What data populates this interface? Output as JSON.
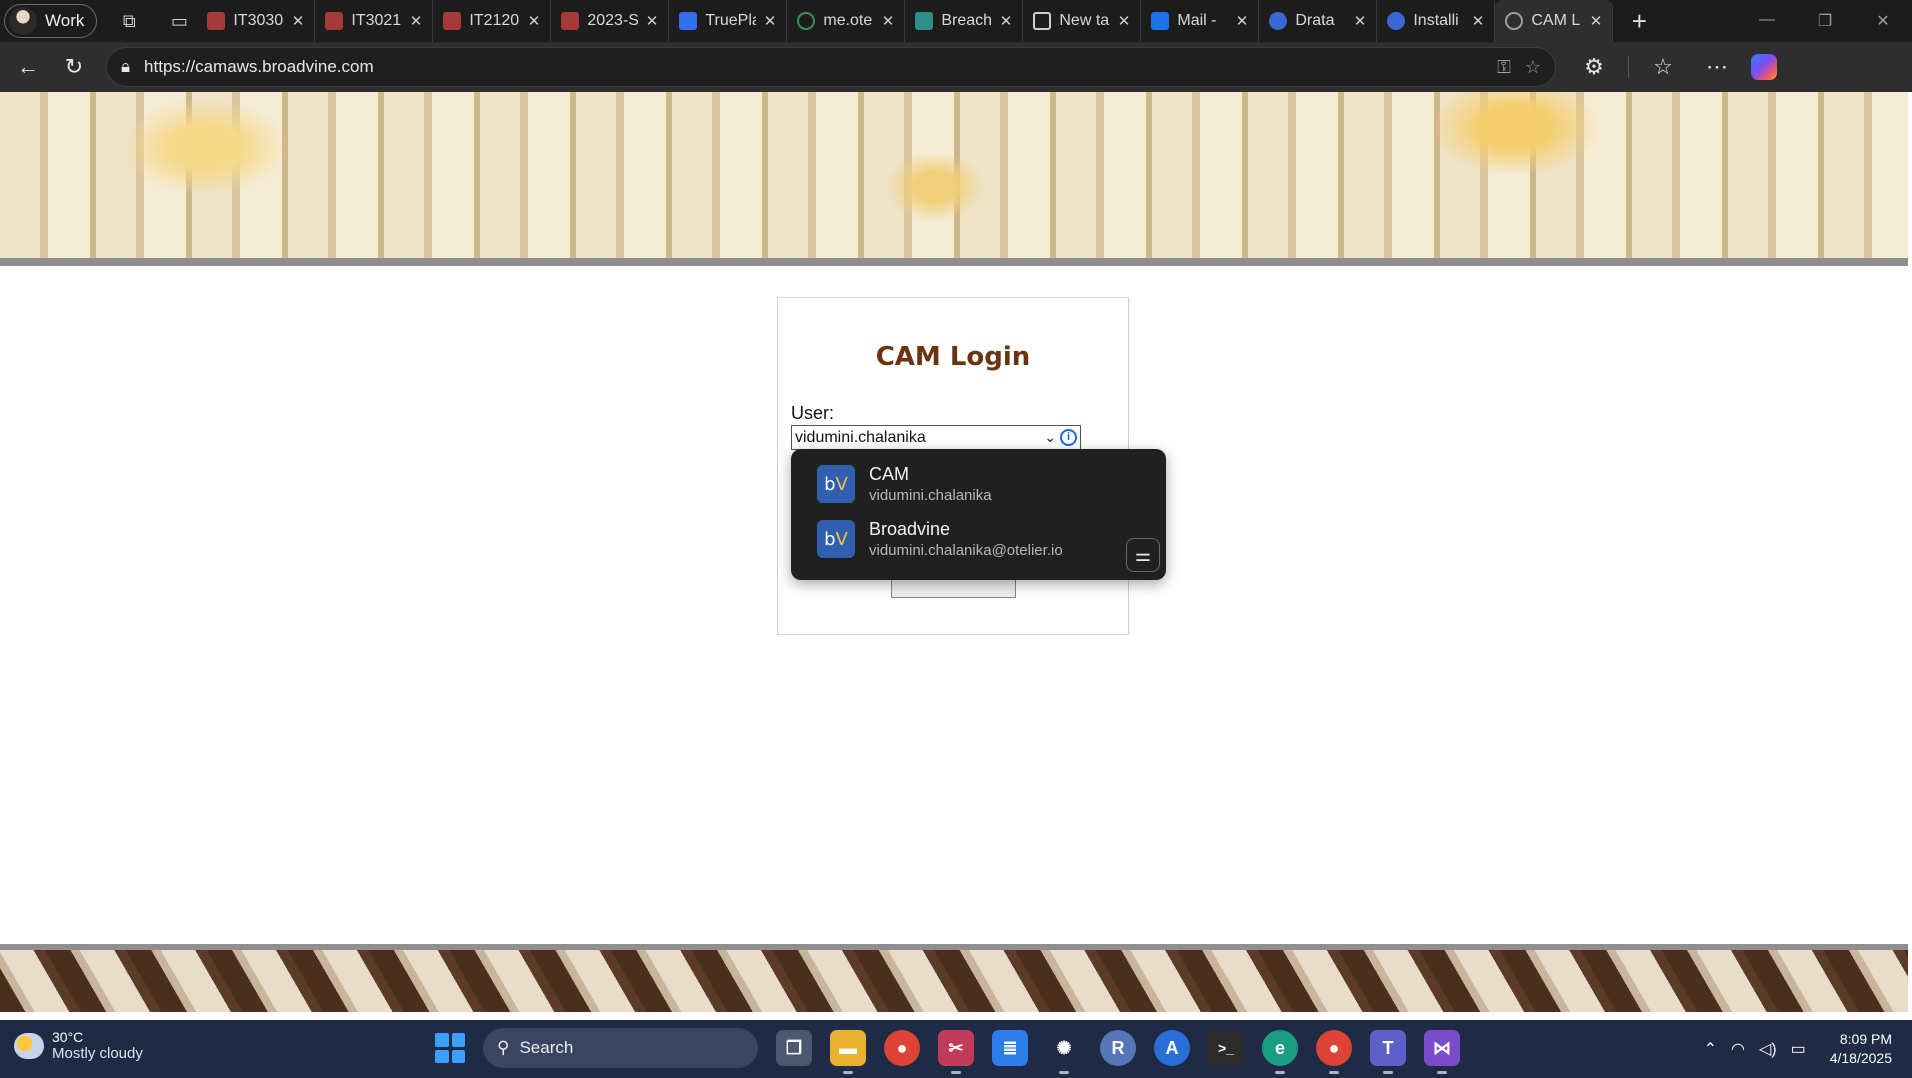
{
  "browser": {
    "profile_label": "Work",
    "tabs": [
      {
        "title": "IT3030",
        "favicon_color": "#a53a3a"
      },
      {
        "title": "IT3021",
        "favicon_color": "#a53a3a"
      },
      {
        "title": "IT2120",
        "favicon_color": "#a53a3a"
      },
      {
        "title": "2023-S",
        "favicon_color": "#a53a3a"
      },
      {
        "title": "TruePla",
        "favicon_color": "#2f6ff0"
      },
      {
        "title": "me.ote",
        "favicon_color": "#3c8f5a"
      },
      {
        "title": "Breach",
        "favicon_color": "#2c8f8a"
      },
      {
        "title": "New ta",
        "favicon_color": "#cfcfcf"
      },
      {
        "title": "Mail -",
        "favicon_color": "#1a73e8"
      },
      {
        "title": "Drata",
        "favicon_color": "#3a66d6"
      },
      {
        "title": "Installi",
        "favicon_color": "#3a66d6"
      },
      {
        "title": "CAM L",
        "favicon_color": "#9aa0a6"
      }
    ],
    "url": "https://camaws.broadvine.com"
  },
  "login": {
    "title": "CAM Login",
    "user_label": "User:",
    "user_value": "vidumini.chalanika",
    "info_glyph": "i"
  },
  "autofill": {
    "items": [
      {
        "logo_prefix": "b",
        "logo_suffix": "V",
        "name": "CAM",
        "account": "vidumini.chalanika"
      },
      {
        "logo_prefix": "b",
        "logo_suffix": "V",
        "name": "Broadvine",
        "account": "vidumini.chalanika@otelier.io"
      }
    ]
  },
  "taskbar": {
    "weather_temp": "30°C",
    "weather_desc": "Mostly cloudy",
    "search_label": "Search",
    "time": "8:09 PM",
    "date": "4/18/2025",
    "apps": [
      {
        "icon": "task-view-icon",
        "glyph": "❐",
        "color": "#4b5870"
      },
      {
        "icon": "file-explorer-icon",
        "glyph": "▬",
        "color": "#e8b230"
      },
      {
        "icon": "chrome-icon",
        "glyph": "●",
        "color": "#db4437"
      },
      {
        "icon": "snipping-tool-icon",
        "glyph": "✂",
        "color": "#c23a5a"
      },
      {
        "icon": "notepad-icon",
        "glyph": "≣",
        "color": "#2b7de9"
      },
      {
        "icon": "chatgpt-icon",
        "glyph": "✺",
        "color": "#1f2a44"
      },
      {
        "icon": "r-icon",
        "glyph": "R",
        "color": "#5576b8"
      },
      {
        "icon": "app-a-icon",
        "glyph": "A",
        "color": "#2a6fd6"
      },
      {
        "icon": "terminal-icon",
        "glyph": ">_",
        "color": "#2b2b2b"
      },
      {
        "icon": "edge-icon",
        "glyph": "e",
        "color": "#1a9d7f"
      },
      {
        "icon": "chrome-profile-icon",
        "glyph": "●",
        "color": "#db4437"
      },
      {
        "icon": "teams-icon",
        "glyph": "T",
        "color": "#5b5fc7"
      },
      {
        "icon": "visual-studio-icon",
        "glyph": "⋈",
        "color": "#7a4cc9"
      }
    ]
  }
}
